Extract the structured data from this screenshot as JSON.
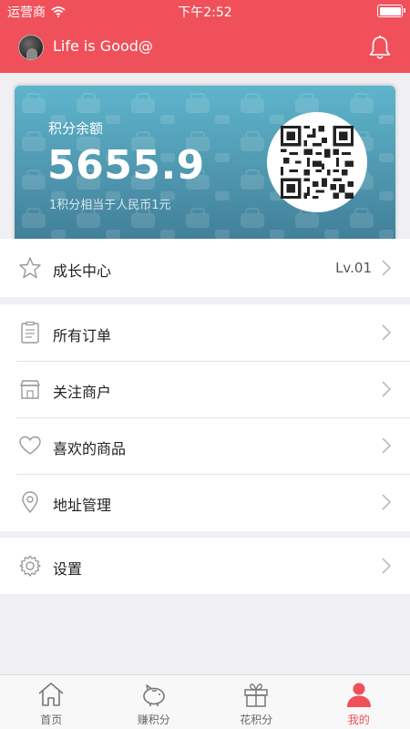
{
  "status_bar": {
    "carrier": "运营商",
    "time": "下午2:52",
    "battery_level": 1.0
  },
  "header": {
    "username": "Life is Good@"
  },
  "points_card": {
    "label": "积分余额",
    "amount": "5655.9",
    "note": "1积分相当于人民币1元"
  },
  "growth": {
    "label": "成长中心",
    "level": "Lv.01"
  },
  "menu": [
    {
      "label": "所有订单",
      "icon": "clipboard-icon"
    },
    {
      "label": "关注商户",
      "icon": "store-icon"
    },
    {
      "label": "喜欢的商品",
      "icon": "heart-icon"
    },
    {
      "label": "地址管理",
      "icon": "location-pin-icon"
    }
  ],
  "settings": {
    "label": "设置",
    "icon": "gear-icon"
  },
  "tabs": [
    {
      "label": "首页",
      "icon": "home-icon",
      "active": false
    },
    {
      "label": "赚积分",
      "icon": "piggy-bank-icon",
      "active": false
    },
    {
      "label": "花积分",
      "icon": "gift-icon",
      "active": false
    },
    {
      "label": "我的",
      "icon": "user-icon",
      "active": true
    }
  ],
  "colors": {
    "brand": "#f0505a",
    "card": "#4d93ab",
    "background": "#efeff4"
  }
}
